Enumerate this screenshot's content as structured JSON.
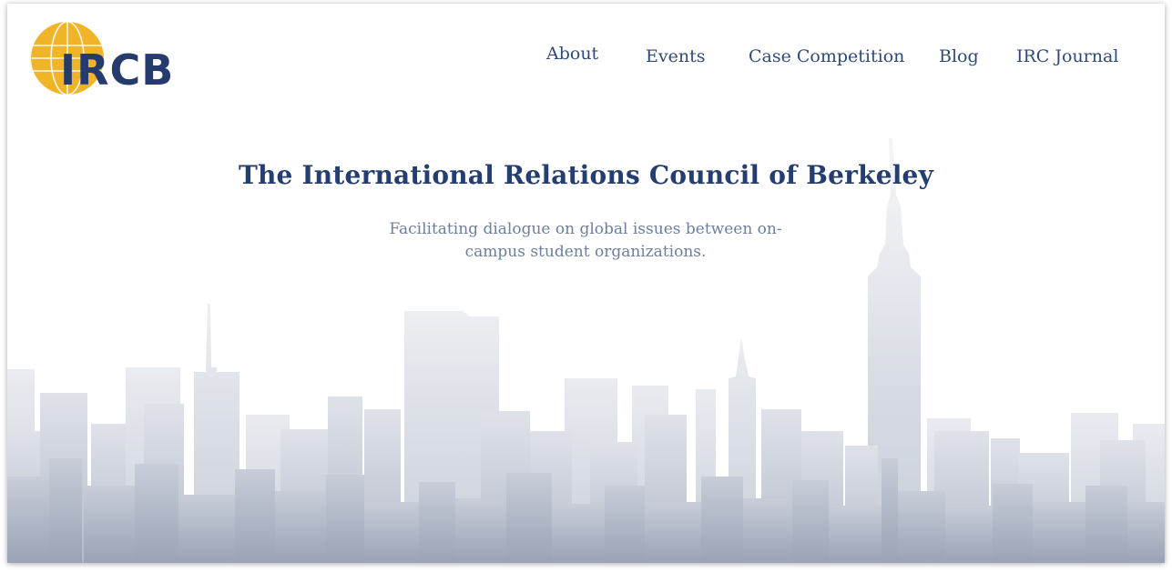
{
  "brand": {
    "logo_text": "IRCB",
    "globe_color": "#f0b429",
    "text_color": "#253b6e"
  },
  "nav": {
    "items": [
      {
        "id": "about",
        "label": "About"
      },
      {
        "id": "events",
        "label": "Events"
      },
      {
        "id": "case-competition",
        "label": "Case Competition"
      },
      {
        "id": "blog",
        "label": "Blog"
      },
      {
        "id": "irc-journal",
        "label": "IRC Journal"
      }
    ]
  },
  "hero": {
    "title": "The International Relations Council of Berkeley",
    "subtitle": "Facilitating dialogue on global issues between on-campus student organizations."
  },
  "theme": {
    "accent": "#253e70",
    "nav_color": "#2f4a7a",
    "subtitle_color": "#6d7f9c",
    "skyline_color": "#a7afc0"
  }
}
